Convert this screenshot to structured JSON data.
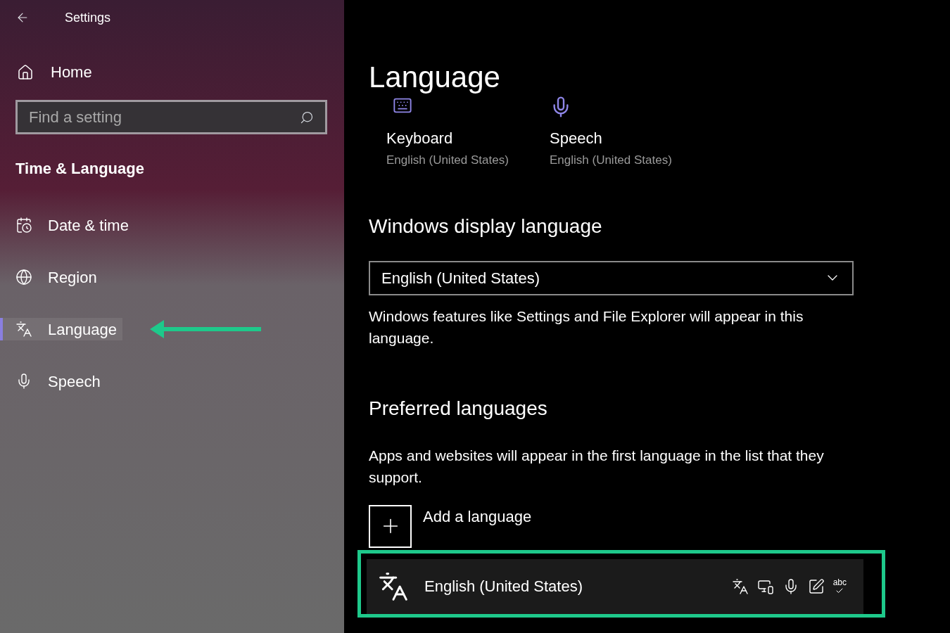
{
  "window": {
    "title": "Settings"
  },
  "sidebar": {
    "home": "Home",
    "search": {
      "placeholder": "Find a setting"
    },
    "section": "Time & Language",
    "items": [
      {
        "label": "Date & time",
        "kind": "clock",
        "selected": false
      },
      {
        "label": "Region",
        "kind": "globe",
        "selected": false
      },
      {
        "label": "Language",
        "kind": "language",
        "selected": true
      },
      {
        "label": "Speech",
        "kind": "mic",
        "selected": false
      }
    ]
  },
  "page": {
    "title": "Language",
    "quick_links": [
      {
        "kind": "keyboard",
        "label": "Keyboard",
        "value": "English (United States)"
      },
      {
        "kind": "speech",
        "label": "Speech",
        "value": "English (United States)"
      }
    ],
    "display_language": {
      "heading": "Windows display language",
      "value": "English (United States)",
      "note": "Windows features like Settings and File Explorer will appear in this language."
    },
    "preferred": {
      "heading": "Preferred languages",
      "note": "Apps and websites will appear in the first language in the list that they support.",
      "add": "Add a language",
      "languages": [
        {
          "name": "English (United States)",
          "features": [
            {
              "kind": "language"
            },
            {
              "kind": "display"
            },
            {
              "kind": "speech"
            },
            {
              "kind": "handwriting"
            },
            {
              "kind": "spelling",
              "label": "abc"
            }
          ]
        }
      ]
    }
  }
}
